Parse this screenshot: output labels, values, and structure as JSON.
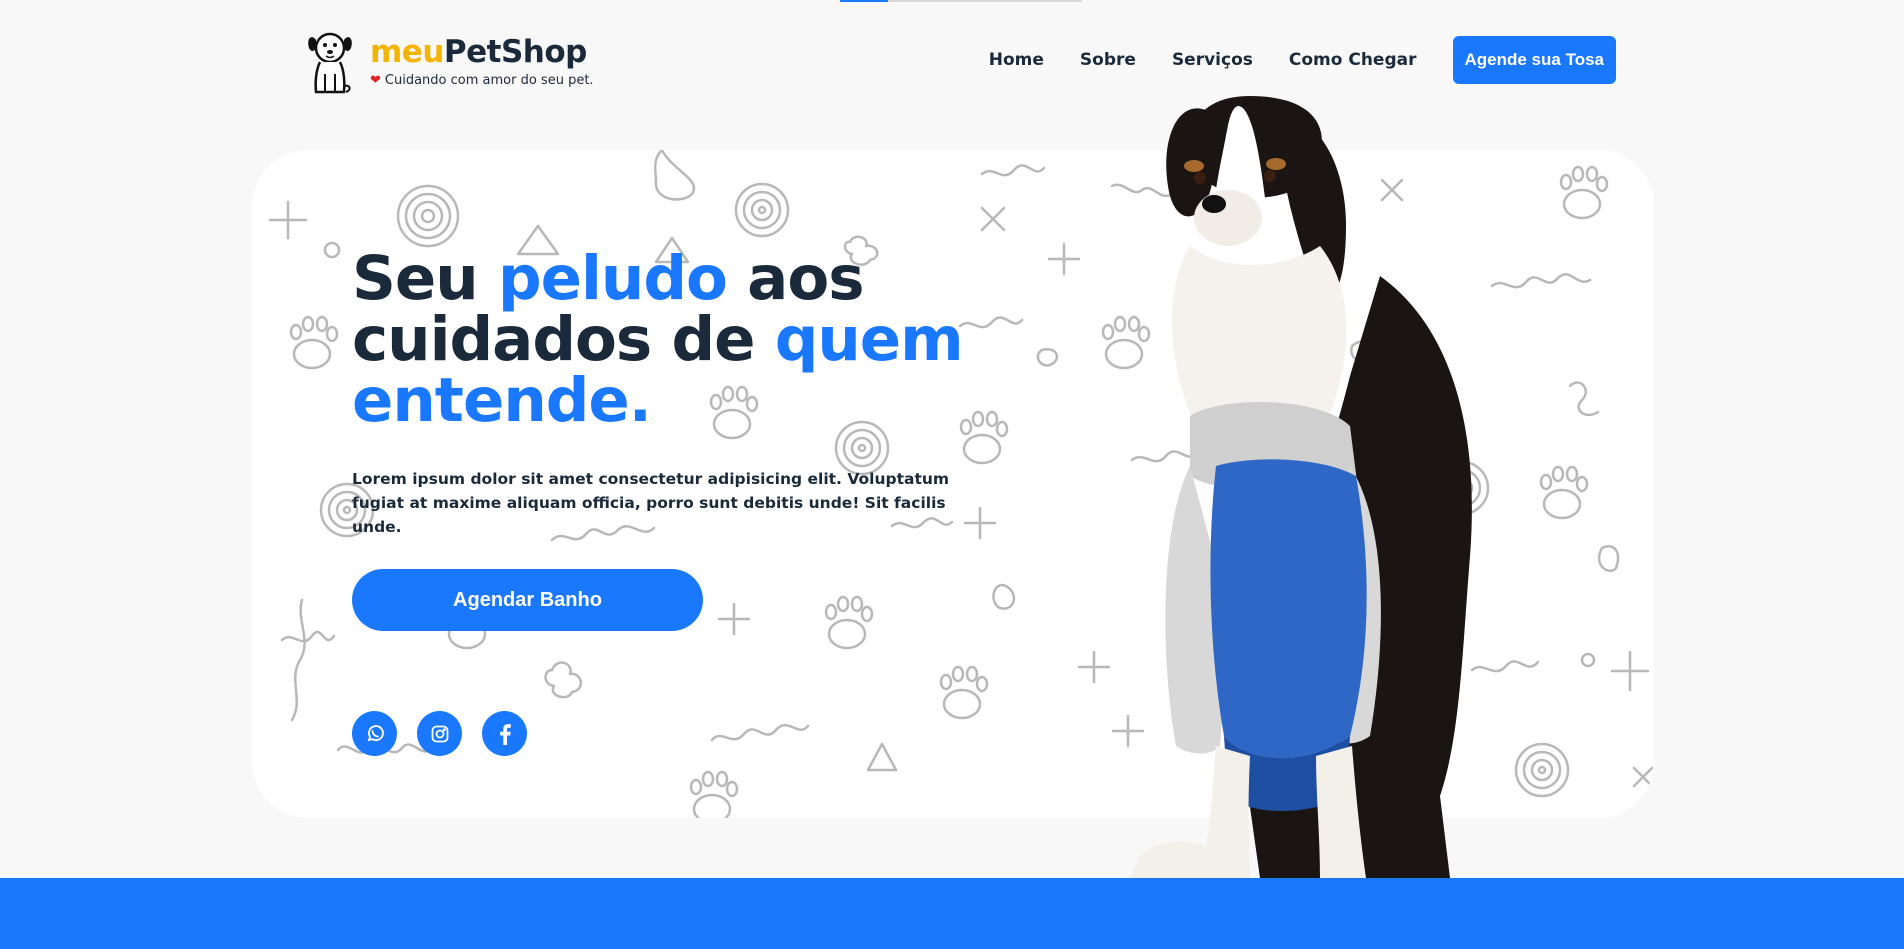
{
  "progress": {
    "value": 0.2
  },
  "brand": {
    "name_part1": "meu",
    "name_part2": "PetShop",
    "tagline": "Cuidando com amor do seu pet.",
    "logo_icon": "dog-logo-icon",
    "heart_icon": "heart-icon"
  },
  "nav": {
    "items": [
      {
        "label": "Home"
      },
      {
        "label": "Sobre"
      },
      {
        "label": "Serviços"
      },
      {
        "label": "Como Chegar"
      }
    ],
    "cta_label": "Agende sua Tosa"
  },
  "hero": {
    "headline": {
      "w1": "Seu ",
      "w2": "peludo",
      "w3": " aos",
      "w4": "cuidados de ",
      "w5": "quem",
      "w6": "entende."
    },
    "lead": "Lorem ipsum dolor sit amet consectetur adipisicing elit. Voluptatum fugiat at maxime aliquam officia, porro sunt debitis unde! Sit facilis unde.",
    "button_label": "Agendar Banho",
    "socials": [
      {
        "icon": "whatsapp-icon"
      },
      {
        "icon": "instagram-icon"
      },
      {
        "icon": "facebook-icon"
      }
    ],
    "image": "dog-in-hoodie"
  },
  "colors": {
    "accent": "#1a78ff",
    "brand_yellow": "#f5b400",
    "text_dark": "#1b2a3a",
    "background": "#f8f8f8"
  }
}
